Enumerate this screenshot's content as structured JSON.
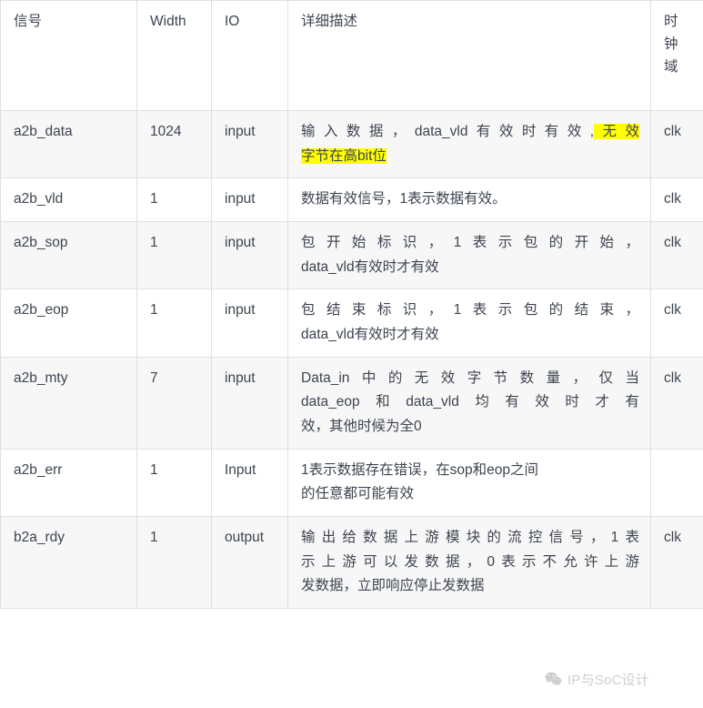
{
  "table": {
    "columns": [
      {
        "key": "signal",
        "label": "信号"
      },
      {
        "key": "width",
        "label": "Width"
      },
      {
        "key": "io",
        "label": "IO"
      },
      {
        "key": "desc",
        "label": "详细描述"
      },
      {
        "key": "clk",
        "label": "时钟域"
      }
    ],
    "rows": [
      {
        "signal": "a2b_data",
        "width": "1024",
        "io": "input",
        "desc_line1_plain": "输入数据，data_vld有效时有效,",
        "desc_line1_highlight": "无效",
        "desc_line2_highlight": "字节在高bit位",
        "clk": "clk",
        "tinted": true
      },
      {
        "signal": "a2b_vld",
        "width": "1",
        "io": "input",
        "desc_line1": "数据有效信号，1表示数据有效。",
        "clk": "clk",
        "tinted": false
      },
      {
        "signal": "a2b_sop",
        "width": "1",
        "io": "input",
        "desc_line1": "包开始标识，1表示包的开始，",
        "desc_line2": "data_vld有效时才有效",
        "clk": "clk",
        "tinted": true
      },
      {
        "signal": "a2b_eop",
        "width": "1",
        "io": "input",
        "desc_line1": "包结束标识，1表示包的结束，",
        "desc_line2": "data_vld有效时才有效",
        "clk": "clk",
        "tinted": false
      },
      {
        "signal": "a2b_mty",
        "width": "7",
        "io": "input",
        "desc_line1": "Data_in中的无效字节数量，仅当",
        "desc_line2": "data_eop和data_vld均有效时才有",
        "desc_line3": "效，其他时候为全0",
        "clk": "clk",
        "tinted": true
      },
      {
        "signal": "a2b_err",
        "width": "1",
        "io": "Input",
        "desc_line1": "1表示数据存在错误，在sop和eop之间",
        "desc_line2": "的任意都可能有效",
        "clk": "",
        "tinted": false
      },
      {
        "signal": "b2a_rdy",
        "width": "1",
        "io": "output",
        "desc_line1": "输出给数据上游模块的流控信号，1表",
        "desc_line2": "示上游可以发数据，0表示不允许上游",
        "desc_line3": "发数据，立即响应停止发数据",
        "clk": "clk",
        "tinted": true
      }
    ]
  },
  "watermark": {
    "icon": "wechat-icon",
    "text": "IP与SoC设计"
  },
  "colors": {
    "highlight": "#ffff00",
    "text": "#3d4450",
    "border": "#e0e0e0",
    "row_tint": "#f7f7f7"
  }
}
